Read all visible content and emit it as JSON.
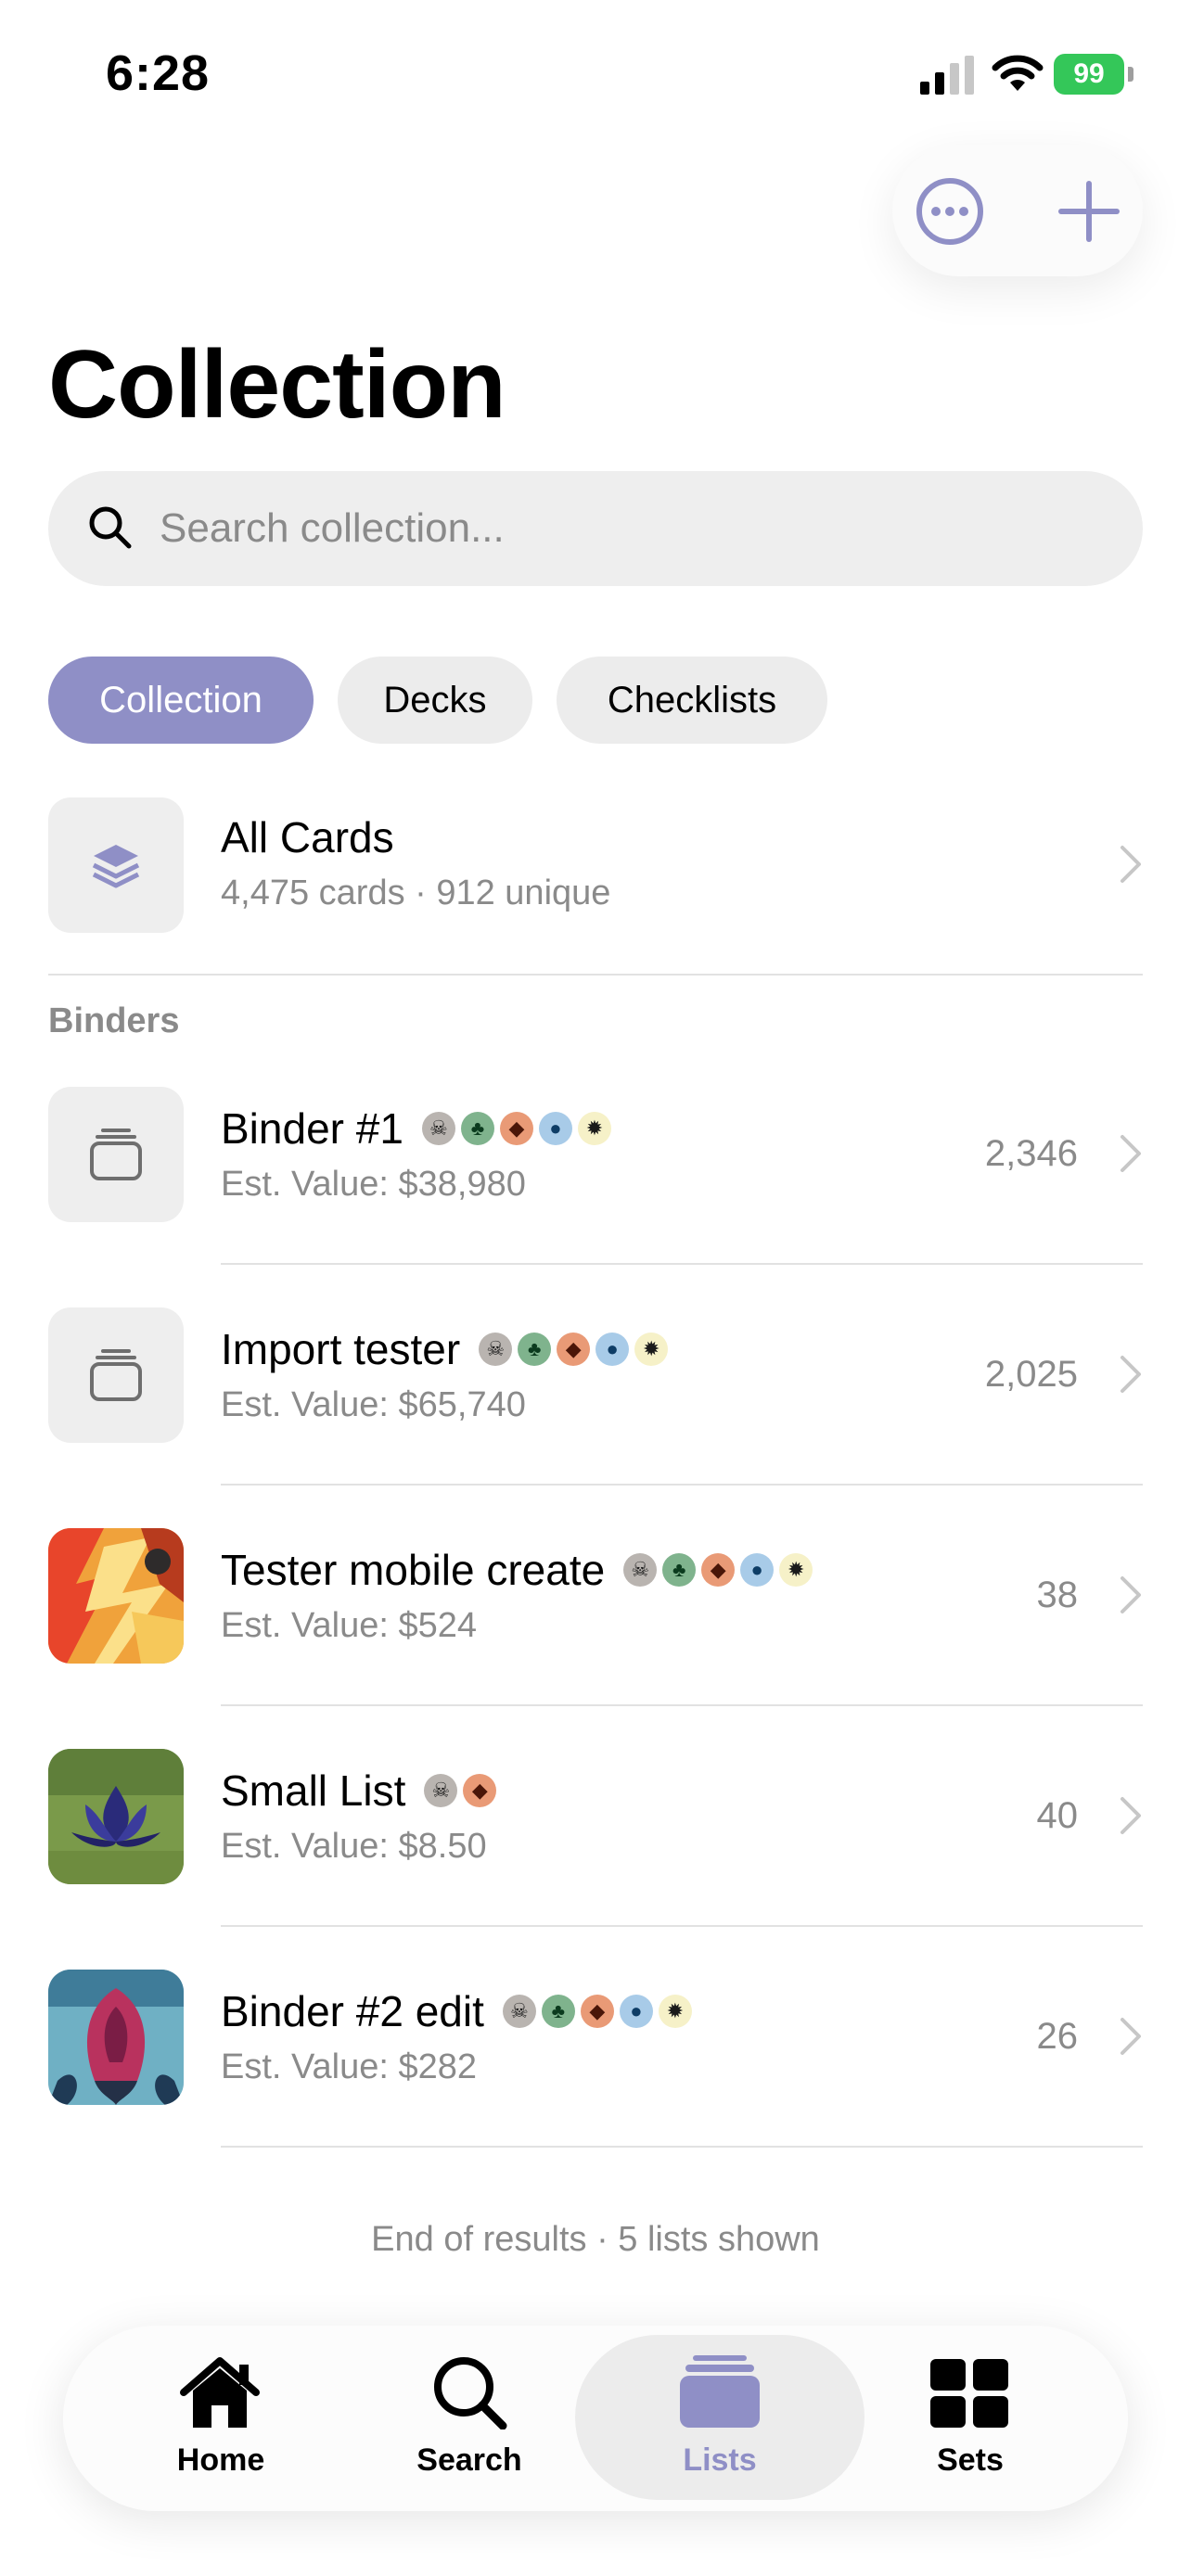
{
  "status": {
    "time": "6:28",
    "battery": "99"
  },
  "header": {
    "title": "Collection",
    "more_icon": "ellipsis-circle-icon",
    "add_icon": "plus-icon"
  },
  "search": {
    "placeholder": "Search collection...",
    "value": ""
  },
  "segments": [
    {
      "label": "Collection",
      "selected": true
    },
    {
      "label": "Decks",
      "selected": false
    },
    {
      "label": "Checklists",
      "selected": false
    }
  ],
  "all_cards": {
    "title": "All Cards",
    "subtitle": "4,475 cards · 912 unique",
    "icon": "stack-layers-icon"
  },
  "binders_section": {
    "label": "Binders"
  },
  "binders": [
    {
      "title": "Binder #1",
      "subtitle": "Est. Value: $38,980",
      "count": "2,346",
      "thumb": "binder-icon",
      "pips": [
        "B",
        "G",
        "R",
        "U",
        "W"
      ]
    },
    {
      "title": "Import tester",
      "subtitle": "Est. Value: $65,740",
      "count": "2,025",
      "thumb": "binder-icon",
      "pips": [
        "B",
        "G",
        "R",
        "U",
        "W"
      ]
    },
    {
      "title": "Tester mobile create",
      "subtitle": "Est. Value: $524",
      "count": "38",
      "thumb": "card-art-fire",
      "pips": [
        "B",
        "G",
        "R",
        "U",
        "W"
      ]
    },
    {
      "title": "Small List",
      "subtitle": "Est. Value: $8.50",
      "count": "40",
      "thumb": "card-art-lotus",
      "pips": [
        "B",
        "R"
      ]
    },
    {
      "title": "Binder #2 edit",
      "subtitle": "Est. Value: $282",
      "count": "26",
      "thumb": "card-art-creature",
      "pips": [
        "B",
        "G",
        "R",
        "U",
        "W"
      ]
    }
  ],
  "footer": {
    "text": "End of results · 5 lists shown"
  },
  "tabs": [
    {
      "label": "Home",
      "icon": "house-icon",
      "active": false
    },
    {
      "label": "Search",
      "icon": "magnifier-icon",
      "active": false
    },
    {
      "label": "Lists",
      "icon": "stack-icon",
      "active": true
    },
    {
      "label": "Sets",
      "icon": "grid-icon",
      "active": false
    }
  ],
  "colors": {
    "accent": "#8f8fc6",
    "muted": "#8a8a8a",
    "battery": "#34c759"
  }
}
